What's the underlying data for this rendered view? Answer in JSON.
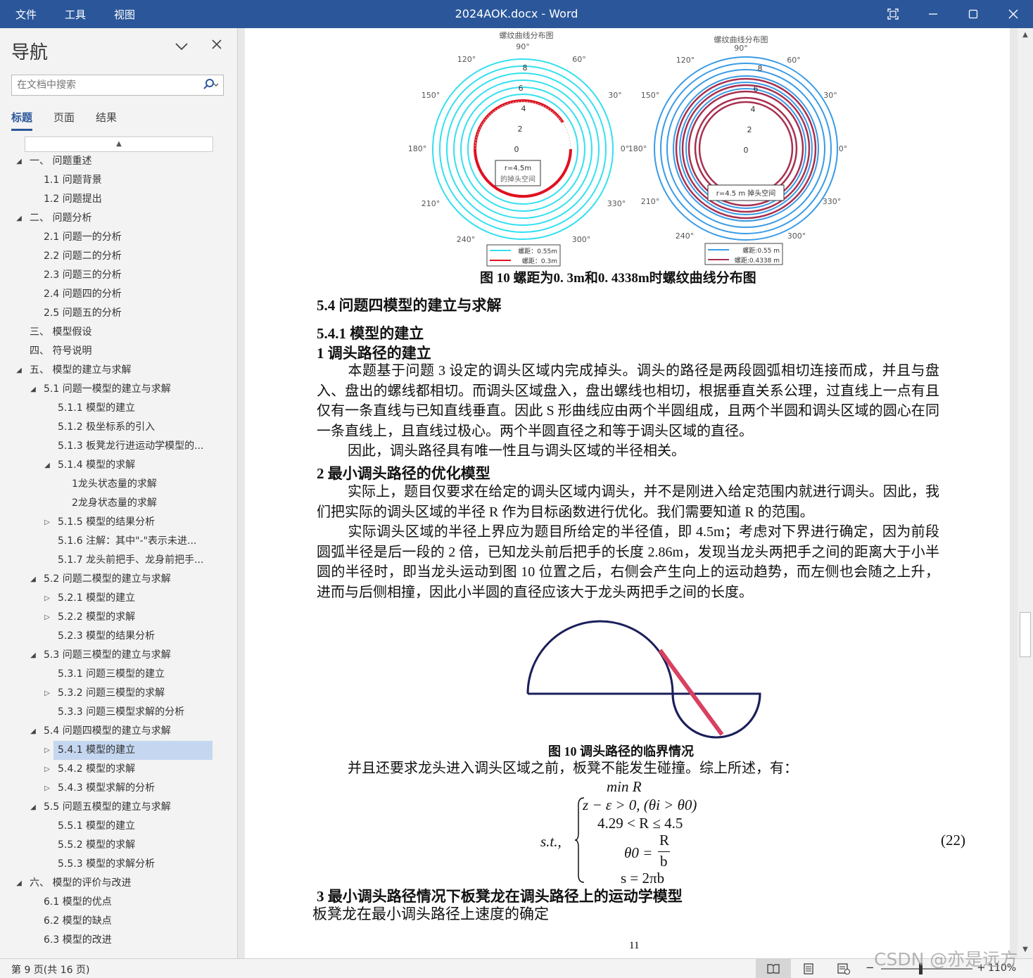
{
  "titlebar": {
    "menu": [
      "文件",
      "工具",
      "视图"
    ],
    "title": "2024AOK.docx  -  Word"
  },
  "nav": {
    "title": "导航",
    "search_placeholder": "在文档中搜索",
    "tabs": [
      "标题",
      "页面",
      "结果"
    ],
    "items": [
      {
        "label": "一、 问题重述",
        "level": 1,
        "toggle": "◢"
      },
      {
        "label": "1.1 问题背景",
        "level": 2,
        "toggle": ""
      },
      {
        "label": "1.2 问题提出",
        "level": 2,
        "toggle": ""
      },
      {
        "label": "二、  问题分析",
        "level": 1,
        "toggle": "◢"
      },
      {
        "label": "2.1 问题一的分析",
        "level": 2,
        "toggle": ""
      },
      {
        "label": "2.2 问题二的分析",
        "level": 2,
        "toggle": ""
      },
      {
        "label": "2.3 问题三的分析",
        "level": 2,
        "toggle": ""
      },
      {
        "label": "2.4 问题四的分析",
        "level": 2,
        "toggle": ""
      },
      {
        "label": "2.5 问题五的分析",
        "level": 2,
        "toggle": ""
      },
      {
        "label": "三、 模型假设",
        "level": 1,
        "toggle": ""
      },
      {
        "label": "四、 符号说明",
        "level": 1,
        "toggle": ""
      },
      {
        "label": "五、 模型的建立与求解",
        "level": 1,
        "toggle": "◢"
      },
      {
        "label": "5.1 问题一模型的建立与求解",
        "level": 2,
        "toggle": "◢"
      },
      {
        "label": "5.1.1 模型的建立",
        "level": 3,
        "toggle": ""
      },
      {
        "label": "5.1.2 极坐标系的引入",
        "level": 3,
        "toggle": ""
      },
      {
        "label": "5.1.3 板凳龙行进运动学模型的...",
        "level": 3,
        "toggle": ""
      },
      {
        "label": "5.1.4 模型的求解",
        "level": 3,
        "toggle": "◢"
      },
      {
        "label": "1龙头状态量的求解",
        "level": 4,
        "toggle": ""
      },
      {
        "label": "2龙身状态量的求解",
        "level": 4,
        "toggle": ""
      },
      {
        "label": "5.1.5 模型的结果分析",
        "level": 3,
        "toggle": "▷"
      },
      {
        "label": "5.1.6 注解：其中\"-\"表示未进...",
        "level": 3,
        "toggle": ""
      },
      {
        "label": "5.1.7 龙头前把手、龙身前把手...",
        "level": 3,
        "toggle": ""
      },
      {
        "label": "5.2 问题二模型的建立与求解",
        "level": 2,
        "toggle": "◢"
      },
      {
        "label": "5.2.1 模型的建立",
        "level": 3,
        "toggle": "▷"
      },
      {
        "label": "5.2.2 模型的求解",
        "level": 3,
        "toggle": "▷"
      },
      {
        "label": "5.2.3 模型的结果分析",
        "level": 3,
        "toggle": ""
      },
      {
        "label": "5.3 问题三模型的建立与求解",
        "level": 2,
        "toggle": "◢"
      },
      {
        "label": "5.3.1 问题三模型的建立",
        "level": 3,
        "toggle": ""
      },
      {
        "label": "5.3.2 问题三模型的求解",
        "level": 3,
        "toggle": "▷"
      },
      {
        "label": "5.3.3 问题三模型求解的分析",
        "level": 3,
        "toggle": ""
      },
      {
        "label": "5.4 问题四模型的建立与求解",
        "level": 2,
        "toggle": "◢"
      },
      {
        "label": "5.4.1 模型的建立",
        "level": 3,
        "toggle": "▷",
        "selected": true
      },
      {
        "label": "5.4.2 模型的求解",
        "level": 3,
        "toggle": "▷"
      },
      {
        "label": "5.4.3 模型求解的分析",
        "level": 3,
        "toggle": "▷"
      },
      {
        "label": "5.5 问题五模型的建立与求解",
        "level": 2,
        "toggle": "◢"
      },
      {
        "label": "5.5.1 模型的建立",
        "level": 3,
        "toggle": ""
      },
      {
        "label": "5.5.2 模型的求解",
        "level": 3,
        "toggle": ""
      },
      {
        "label": "5.5.3 模型的求解分析",
        "level": 3,
        "toggle": ""
      },
      {
        "label": "六、 模型的评价与改进",
        "level": 1,
        "toggle": "◢"
      },
      {
        "label": "6.1 模型的优点",
        "level": 2,
        "toggle": ""
      },
      {
        "label": "6.2 模型的缺点",
        "level": 2,
        "toggle": ""
      },
      {
        "label": "6.3 模型的改进",
        "level": 2,
        "toggle": ""
      }
    ]
  },
  "doc": {
    "polar_left": {
      "title": "螺纹曲线分布图",
      "angles": [
        "90°",
        "60°",
        "30°",
        "0°",
        "330°",
        "300°",
        "240°",
        "210°",
        "180°",
        "150°",
        "120°"
      ],
      "radial_ticks": [
        "8",
        "6",
        "4",
        "2",
        "0"
      ],
      "annotation_line1": "r=4.5m",
      "annotation_line2": "的掉头空间",
      "legend": [
        "螺距：0.55m",
        "螺距：0.3m"
      ]
    },
    "polar_right": {
      "title": "螺纹曲线分布图",
      "angles": [
        "90°",
        "60°",
        "30°",
        "0°",
        "330°",
        "300°",
        "240°",
        "210°",
        "180°",
        "150°",
        "120°"
      ],
      "radial_ticks": [
        "8",
        "6",
        "4",
        "2",
        "0"
      ],
      "annotation": "r=4.5 m   掉头空间",
      "legend": [
        "螺距:0.55 m",
        "螺距:0.4338 m"
      ]
    },
    "fig10_caption": "图 10  螺距为0. 3m和0. 4338m时螺纹曲线分布图",
    "h_54": "5.4 问题四模型的建立与求解",
    "h_541": "5.4.1 模型的建立",
    "h_1": "1 调头路径的建立",
    "p1": "本题基于问题 3 设定的调头区域内完成掉头。调头的路径是两段圆弧相切连接而成，并且与盘入、盘出的螺线都相切。而调头区域盘入，盘出螺线也相切，根据垂直关系公理，过直线上一点有且仅有一条直线与已知直线垂直。因此 S 形曲线应由两个半圆组成，且两个半圆和调头区域的圆心在同一条直线上，且直线过极心。两个半圆直径之和等于调头区域的直径。",
    "p2": "因此，调头路径具有唯一性且与调头区域的半径相关。",
    "h_2": "2 最小调头路径的优化模型",
    "p3": "实际上，题目仅要求在给定的调头区域内调头，并不是刚进入给定范围内就进行调头。因此，我们把实际的调头区域的半径 R 作为目标函数进行优化。我们需要知道 R 的范围。",
    "p4": "实际调头区域的半径上界应为题目所给定的半径值，即 4.5m；考虑对下界进行确定，因为前段圆弧半径是后一段的 2 倍，已知龙头前后把手的长度 2.86m，发现当龙头两把手之间的距离大于小半圆的半径时，即当龙头运动到图 10 位置之后，右侧会产生向上的运动趋势，而左侧也会随之上升，进而与后侧相撞，因此小半圆的直径应该大于龙头两把手之间的长度。",
    "fig10b_caption": "图 10  调头路径的临界情况",
    "p5": "并且还要求龙头进入调头区域之前，板凳不能发生碰撞。综上所述，有：",
    "eq_min": "min R",
    "eq_st": "s.t.,",
    "eq_c1": "z − ε > 0, (θi > θ0)",
    "eq_c2": "4.29 < R ≤ 4.5",
    "eq_c3a": "θ0 =",
    "eq_c3n": "R",
    "eq_c3d": "b",
    "eq_c4": "s = 2πb",
    "eq_num": "(22)",
    "h_3": "3 最小调头路径情况下板凳龙在调头路径上的运动学模型",
    "h_3a": "板凳龙在最小调头路径上速度的确定",
    "page_number": "11"
  },
  "status": {
    "page_info": "第 9 页(共 16 页)",
    "zoom": "110%",
    "watermark": "CSDN @亦是远方"
  },
  "colors": {
    "accent": "#2b579a",
    "cyan_curve": "#34e0f0",
    "red_curve": "#e01020",
    "blue_curve": "#3a9be6",
    "dark_red_curve": "#a83050",
    "semicircle": "#1a1f5a",
    "chord": "#d94060"
  }
}
